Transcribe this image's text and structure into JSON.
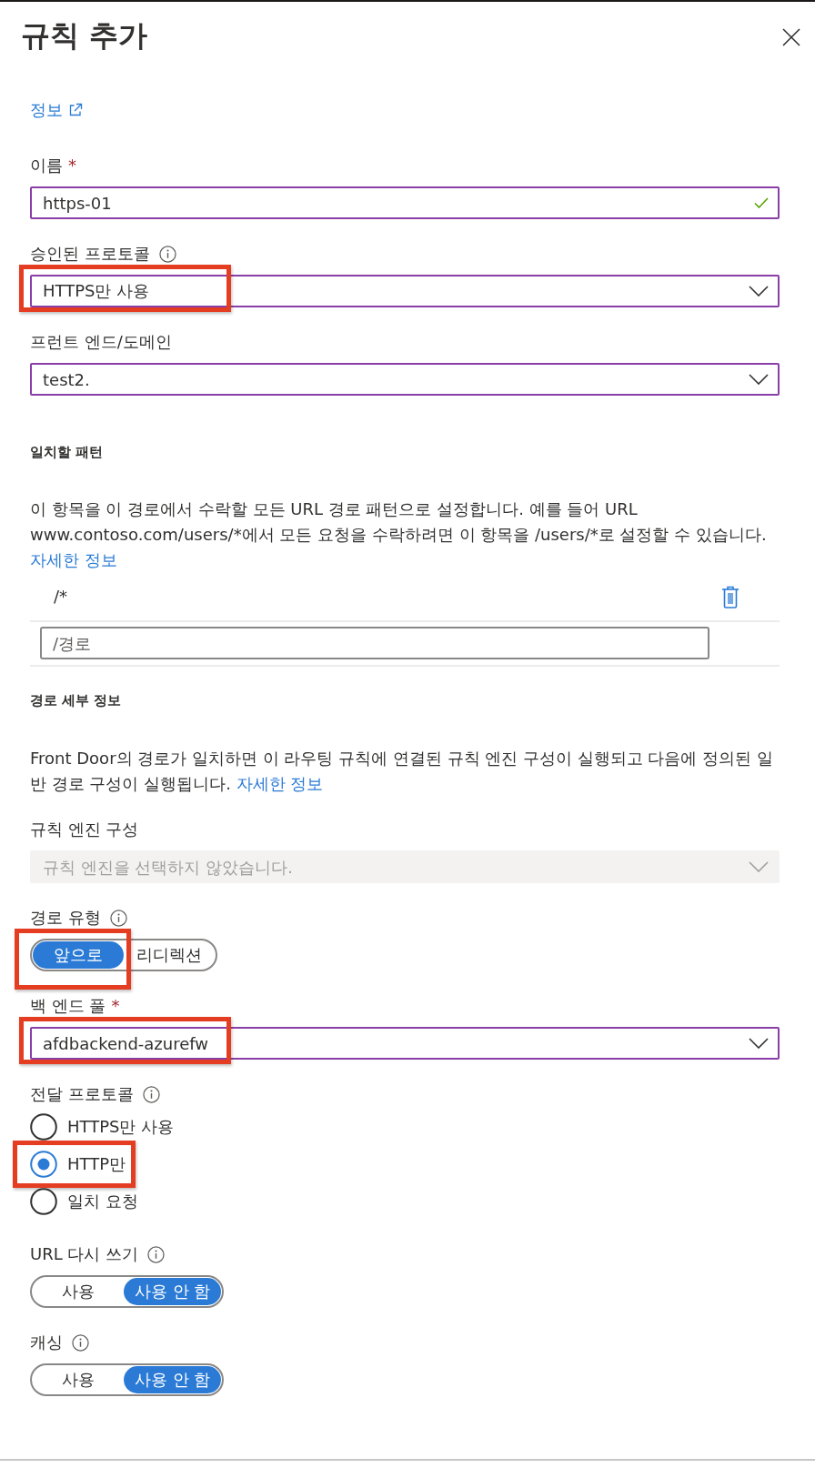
{
  "panel": {
    "title": "규칙 추가",
    "info_link": "정보"
  },
  "fields": [
    {
      "kind": "text",
      "label": "이름",
      "required_mark": "*",
      "info": false,
      "value": "https-01",
      "valid": true,
      "highlighted": false
    },
    {
      "kind": "select",
      "label": "승인된 프로토콜",
      "info": true,
      "disabled": false,
      "value": "HTTPS만 사용",
      "highlighted": true
    },
    {
      "kind": "select",
      "label": "프런트 엔드/도메인",
      "info": false,
      "disabled": false,
      "value": "test2.",
      "highlighted": false
    }
  ],
  "match_pattern": {
    "heading": "일치할 패턴",
    "description": "이 항목을 이 경로에서 수락할 모든 URL 경로 패턴으로 설정합니다. 예를 들어 URL www.contoso.com/users/*에서 모든 요청을 수락하려면 이 항목을 /users/*로 설정할 수 있습니다.",
    "link": "자세한 정보",
    "patterns": [
      "/*"
    ],
    "new_pattern": {
      "placeholder": "/경로"
    }
  },
  "route_details": {
    "heading": "경로 세부 정보",
    "description": "Front Door의 경로가 일치하면 이 라우팅 규칙에 연결된 규칙 엔진 구성이 실행되고 다음에 정의된 일반 경로 구성이 실행됩니다.",
    "link": "자세한 정보",
    "fields": [
      {
        "kind": "select",
        "label": "규칙 엔진 구성",
        "info": false,
        "disabled": true,
        "placeholder": "규칙 엔진을 선택하지 않았습니다.",
        "highlighted": false
      },
      {
        "kind": "segmented",
        "label": "경로 유형",
        "info": true,
        "options": [
          {
            "label": "앞으로",
            "selected": true,
            "highlighted": true
          },
          {
            "label": "리디렉션",
            "selected": false,
            "highlighted": false
          }
        ]
      },
      {
        "kind": "select",
        "label": "백 엔드 풀",
        "required_mark": "*",
        "info": false,
        "disabled": false,
        "value": "afdbackend-azurefw",
        "highlighted": true
      },
      {
        "kind": "radio",
        "label": "전달 프로토콜",
        "info": true,
        "options": [
          {
            "label": "HTTPS만 사용",
            "selected": false,
            "highlighted": false
          },
          {
            "label": "HTTP만",
            "selected": true,
            "highlighted": true
          },
          {
            "label": "일치 요청",
            "selected": false,
            "highlighted": false
          }
        ]
      },
      {
        "kind": "segmented",
        "label": "URL 다시 쓰기",
        "info": true,
        "options": [
          {
            "label": "사용",
            "selected": false,
            "highlighted": false
          },
          {
            "label": "사용 안 함",
            "selected": true,
            "highlighted": false
          }
        ]
      },
      {
        "kind": "segmented",
        "label": "캐싱",
        "info": true,
        "options": [
          {
            "label": "사용",
            "selected": false,
            "highlighted": false
          },
          {
            "label": "사용 안 함",
            "selected": true,
            "highlighted": false
          }
        ]
      }
    ]
  }
}
